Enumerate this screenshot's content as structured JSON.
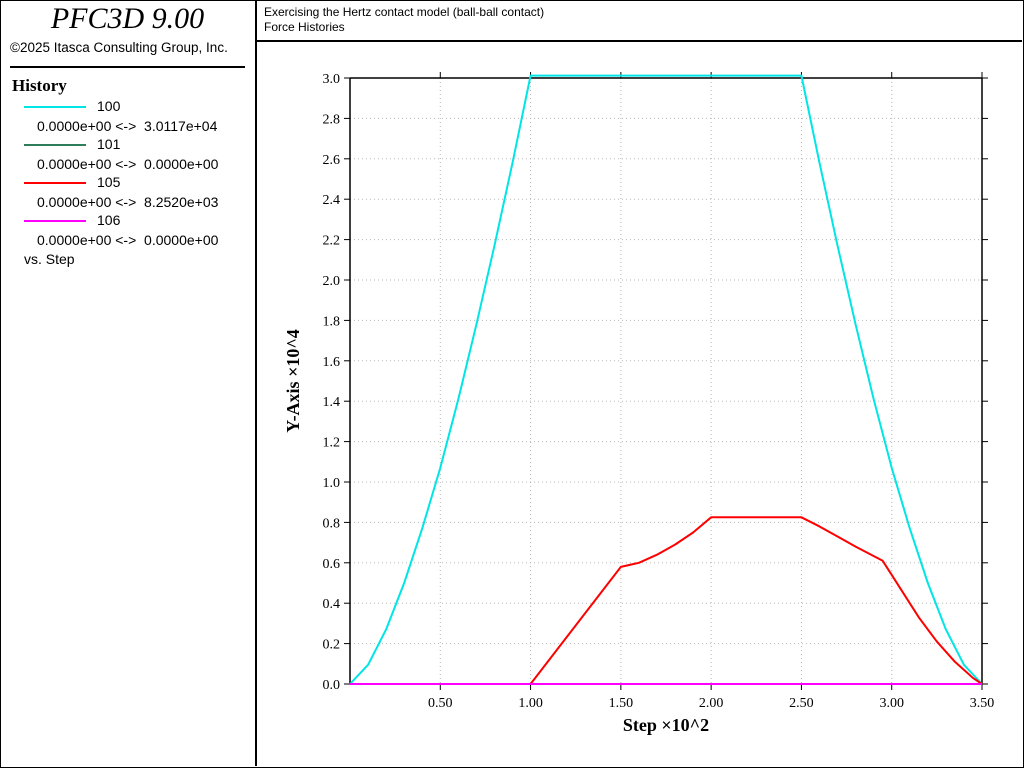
{
  "app": {
    "title": "PFC3D 9.00",
    "copyright": "©2025 Itasca Consulting Group, Inc."
  },
  "header": {
    "line1": "Exercising the Hertz contact model (ball-ball contact)",
    "line2": "Force Histories"
  },
  "legend": {
    "heading": "History",
    "entries": [
      {
        "name": "100",
        "range": "0.0000e+00 <->  3.0117e+04",
        "color": "#00e5e5"
      },
      {
        "name": "101",
        "range": "0.0000e+00 <->  0.0000e+00",
        "color": "#2e7d5b"
      },
      {
        "name": "105",
        "range": "0.0000e+00 <->  8.2520e+03",
        "color": "#ff0000"
      },
      {
        "name": "106",
        "range": "0.0000e+00 <->  0.0000e+00",
        "color": "#ff00ff"
      }
    ],
    "vs": "vs. Step"
  },
  "chart_data": {
    "type": "line",
    "xlabel": "Step ×10^2",
    "ylabel": "Y-Axis ×10^4",
    "xlim": [
      0,
      3.5
    ],
    "ylim": [
      0,
      3.0
    ],
    "x_ticks": [
      0.5,
      1.0,
      1.5,
      2.0,
      2.5,
      3.0,
      3.5
    ],
    "x_tick_labels": [
      "0.50",
      "1.00",
      "1.50",
      "2.00",
      "2.50",
      "3.00",
      "3.50"
    ],
    "y_ticks": [
      0.0,
      0.2,
      0.4,
      0.6,
      0.8,
      1.0,
      1.2,
      1.4,
      1.6,
      1.8,
      2.0,
      2.2,
      2.4,
      2.6,
      2.8,
      3.0
    ],
    "y_tick_labels": [
      "0.0",
      "0.2",
      "0.4",
      "0.6",
      "0.8",
      "1.0",
      "1.2",
      "1.4",
      "1.6",
      "1.8",
      "2.0",
      "2.2",
      "2.4",
      "2.6",
      "2.8",
      "3.0"
    ],
    "grid": true,
    "series": [
      {
        "name": "100",
        "color": "#00e5e5",
        "x": [
          0,
          0.1,
          0.2,
          0.3,
          0.4,
          0.5,
          0.6,
          0.7,
          0.8,
          0.9,
          1.0,
          1.5,
          2.0,
          2.5,
          2.6,
          2.7,
          2.8,
          2.9,
          3.0,
          3.1,
          3.2,
          3.3,
          3.4,
          3.5
        ],
        "y": [
          0,
          0.095,
          0.27,
          0.5,
          0.77,
          1.07,
          1.41,
          1.78,
          2.17,
          2.58,
          3.0117,
          3.0117,
          3.0117,
          3.0117,
          2.58,
          2.17,
          1.78,
          1.41,
          1.07,
          0.77,
          0.5,
          0.27,
          0.095,
          0
        ]
      },
      {
        "name": "101",
        "color": "#2e7d5b",
        "x": [
          0,
          3.5
        ],
        "y": [
          0,
          0
        ]
      },
      {
        "name": "105",
        "color": "#ff0000",
        "x": [
          0,
          1.0,
          1.5,
          1.6,
          1.7,
          1.8,
          1.9,
          2.0,
          2.5,
          2.6,
          2.7,
          2.8,
          2.95,
          3.05,
          3.15,
          3.25,
          3.35,
          3.45,
          3.5
        ],
        "y": [
          0,
          0,
          0.58,
          0.6,
          0.64,
          0.69,
          0.75,
          0.8252,
          0.8252,
          0.78,
          0.73,
          0.68,
          0.61,
          0.47,
          0.33,
          0.21,
          0.11,
          0.03,
          0
        ]
      },
      {
        "name": "106",
        "color": "#ff00ff",
        "x": [
          0,
          3.5
        ],
        "y": [
          0,
          0
        ]
      }
    ]
  }
}
